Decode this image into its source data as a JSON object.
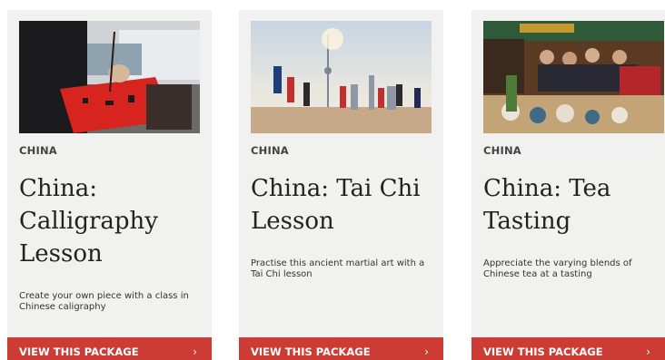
{
  "cards": [
    {
      "eyebrow": "CHINA",
      "title": "China: Calligraphy Lesson",
      "description": "Create your own piece with a class in Chinese caligraphy",
      "cta": "VIEW THIS PACKAGE",
      "cta_icon": "chevron-right-icon"
    },
    {
      "eyebrow": "CHINA",
      "title": "China: Tai Chi Lesson",
      "description": "Practise this ancient martial art with a Tai Chi lesson",
      "cta": "VIEW THIS PACKAGE",
      "cta_icon": "chevron-right-icon"
    },
    {
      "eyebrow": "CHINA",
      "title": "China: Tea Tasting",
      "description": "Appreciate the varying blends of Chinese tea at a tasting",
      "cta": "VIEW THIS PACKAGE",
      "cta_icon": "chevron-right-icon"
    }
  ],
  "colors": {
    "card_bg": "#f1f1f0",
    "cta_bg": "#cc3b34",
    "title": "#222222"
  }
}
